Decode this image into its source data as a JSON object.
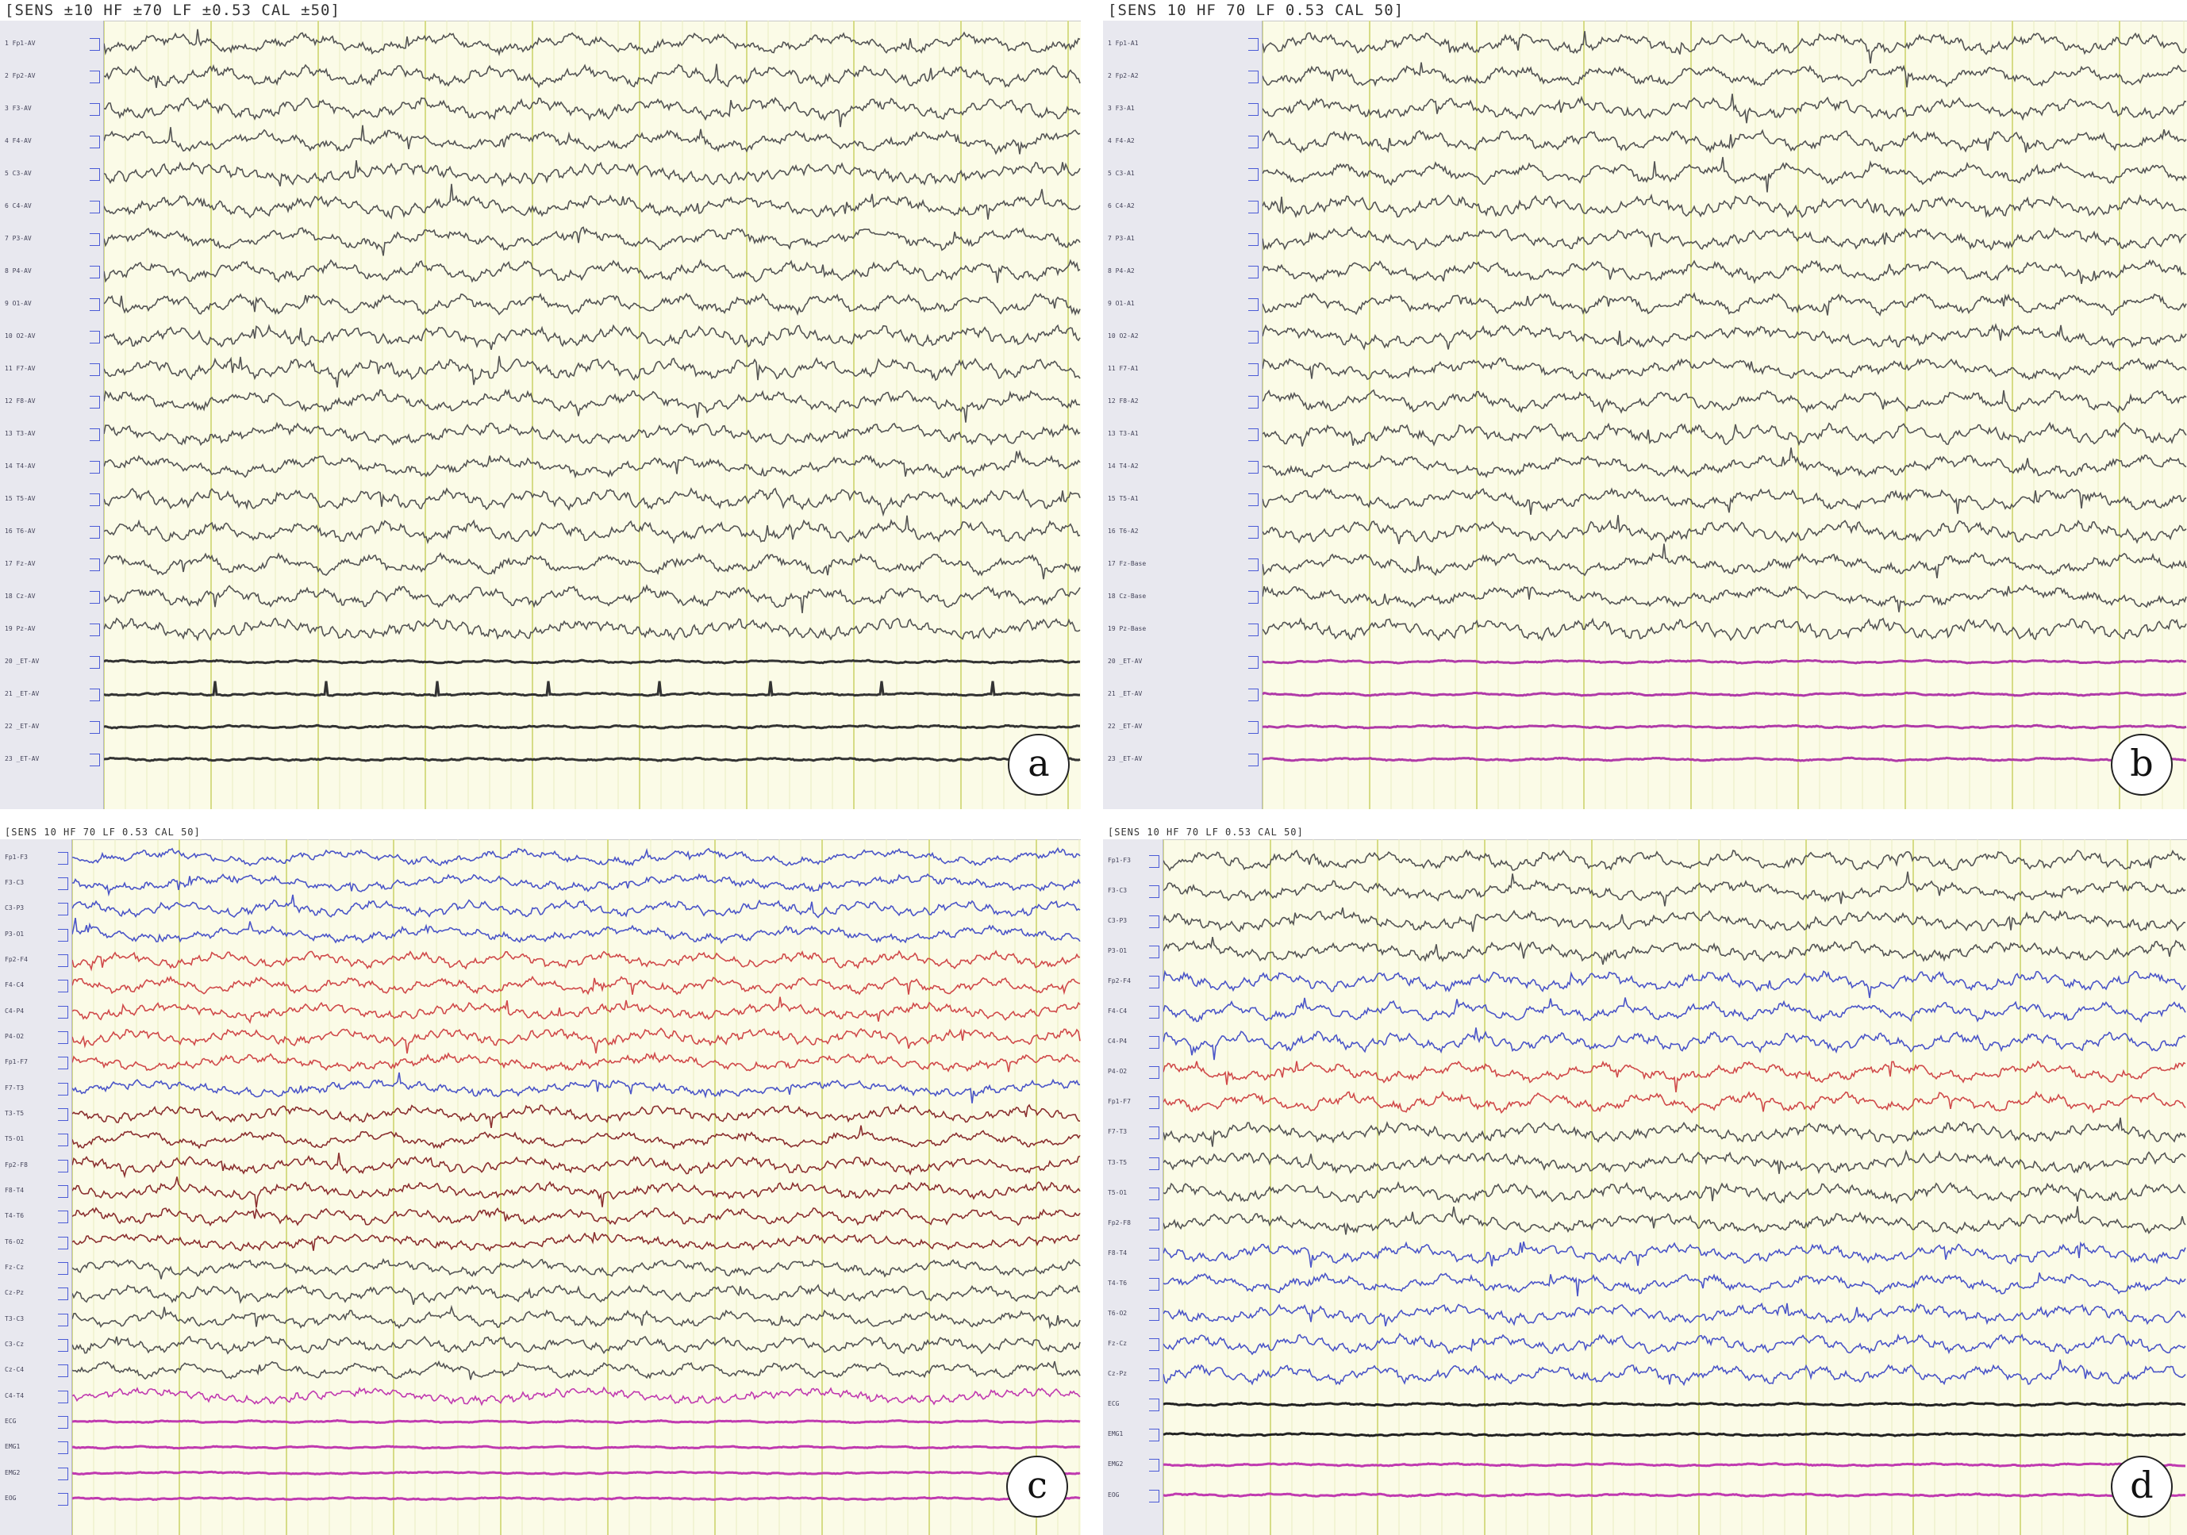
{
  "panels": [
    {
      "id": "a",
      "letter": "a",
      "header": "[SENS ±10  HF ±70  LF ±0.53  CAL ±50]",
      "channel_labels": [
        "1 Fp1-AV",
        "2 Fp2-AV",
        "3 F3-AV",
        "4 F4-AV",
        "5 C3-AV",
        "6 C4-AV",
        "7 P3-AV",
        "8 P4-AV",
        "9 O1-AV",
        "10 O2-AV",
        "11 F7-AV",
        "12 F8-AV",
        "13 T3-AV",
        "14 T4-AV",
        "15 T5-AV",
        "16 T6-AV",
        "17 Fz-AV",
        "18 Cz-AV",
        "19 Pz-AV",
        "20 _ET-AV",
        "21 _ET-AV",
        "22 _ET-AV",
        "23 _ET-AV"
      ],
      "trace_color": "#555555",
      "aux_color": "#333333"
    },
    {
      "id": "b",
      "letter": "b",
      "header": "[SENS 10   HF 70  LF 0.53   CAL 50]",
      "channel_labels": [
        "1 Fp1-A1",
        "2 Fp2-A2",
        "3 F3-A1",
        "4 F4-A2",
        "5 C3-A1",
        "6 C4-A2",
        "7 P3-A1",
        "8 P4-A2",
        "9 O1-A1",
        "10 O2-A2",
        "11 F7-A1",
        "12 F8-A2",
        "13 T3-A1",
        "14 T4-A2",
        "15 T5-A1",
        "16 T6-A2",
        "17 Fz-Base",
        "18 Cz-Base",
        "19 Pz-Base",
        "20 _ET-AV",
        "21 _ET-AV",
        "22 _ET-AV",
        "23 _ET-AV"
      ],
      "trace_color": "#555555",
      "aux_color": "#b03aa8",
      "footer": "×××"
    },
    {
      "id": "c",
      "letter": "c",
      "header": "[SENS 10   HF 70  LF 0.53  CAL 50]",
      "channel_labels": [
        "Fp1-F3",
        "F3-C3",
        "C3-P3",
        "P3-O1",
        "Fp2-F4",
        "F4-C4",
        "C4-P4",
        "P4-O2",
        "Fp1-F7",
        "F7-T3",
        "T3-T5",
        "T5-O1",
        "Fp2-F8",
        "F8-T4",
        "T4-T6",
        "T6-O2",
        "Fz-Cz",
        "Cz-Pz",
        "T3-C3",
        "C3-Cz",
        "Cz-C4",
        "C4-T4",
        "ECG",
        "EMG1",
        "EMG2",
        "EOG"
      ],
      "color_groups": [
        "#4b55c8",
        "#4b55c8",
        "#4b55c8",
        "#4b55c8",
        "#d04a4a",
        "#d04a4a",
        "#d04a4a",
        "#d04a4a",
        "#d04a4a",
        "#4b55c8",
        "#8a2f2f",
        "#8a2f2f",
        "#8a2f2f",
        "#8a2f2f",
        "#8a2f2f",
        "#8a2f2f",
        "#555555",
        "#555555",
        "#555555",
        "#555555",
        "#555555",
        "#c03ab0",
        "#c03ab0",
        "#c03ab0",
        "#c03ab0",
        "#c03ab0"
      ]
    },
    {
      "id": "d",
      "letter": "d",
      "header": "[SENS 10   HF 70  LF 0.53  CAL 50]",
      "channel_labels": [
        "Fp1-F3",
        "F3-C3",
        "C3-P3",
        "P3-O1",
        "Fp2-F4",
        "F4-C4",
        "C4-P4",
        "P4-O2",
        "Fp1-F7",
        "F7-T3",
        "T3-T5",
        "T5-O1",
        "Fp2-F8",
        "F8-T4",
        "T4-T6",
        "T6-O2",
        "Fz-Cz",
        "Cz-Pz",
        "ECG",
        "EMG1",
        "EMG2",
        "EOG"
      ],
      "color_groups": [
        "#555555",
        "#555555",
        "#555555",
        "#555555",
        "#4b55c8",
        "#4b55c8",
        "#4b55c8",
        "#d04a4a",
        "#d04a4a",
        "#555555",
        "#555555",
        "#555555",
        "#555555",
        "#4b55c8",
        "#4b55c8",
        "#4b55c8",
        "#4b55c8",
        "#4b55c8",
        "#222222",
        "#222222",
        "#c03ab0",
        "#c03ab0"
      ]
    }
  ]
}
